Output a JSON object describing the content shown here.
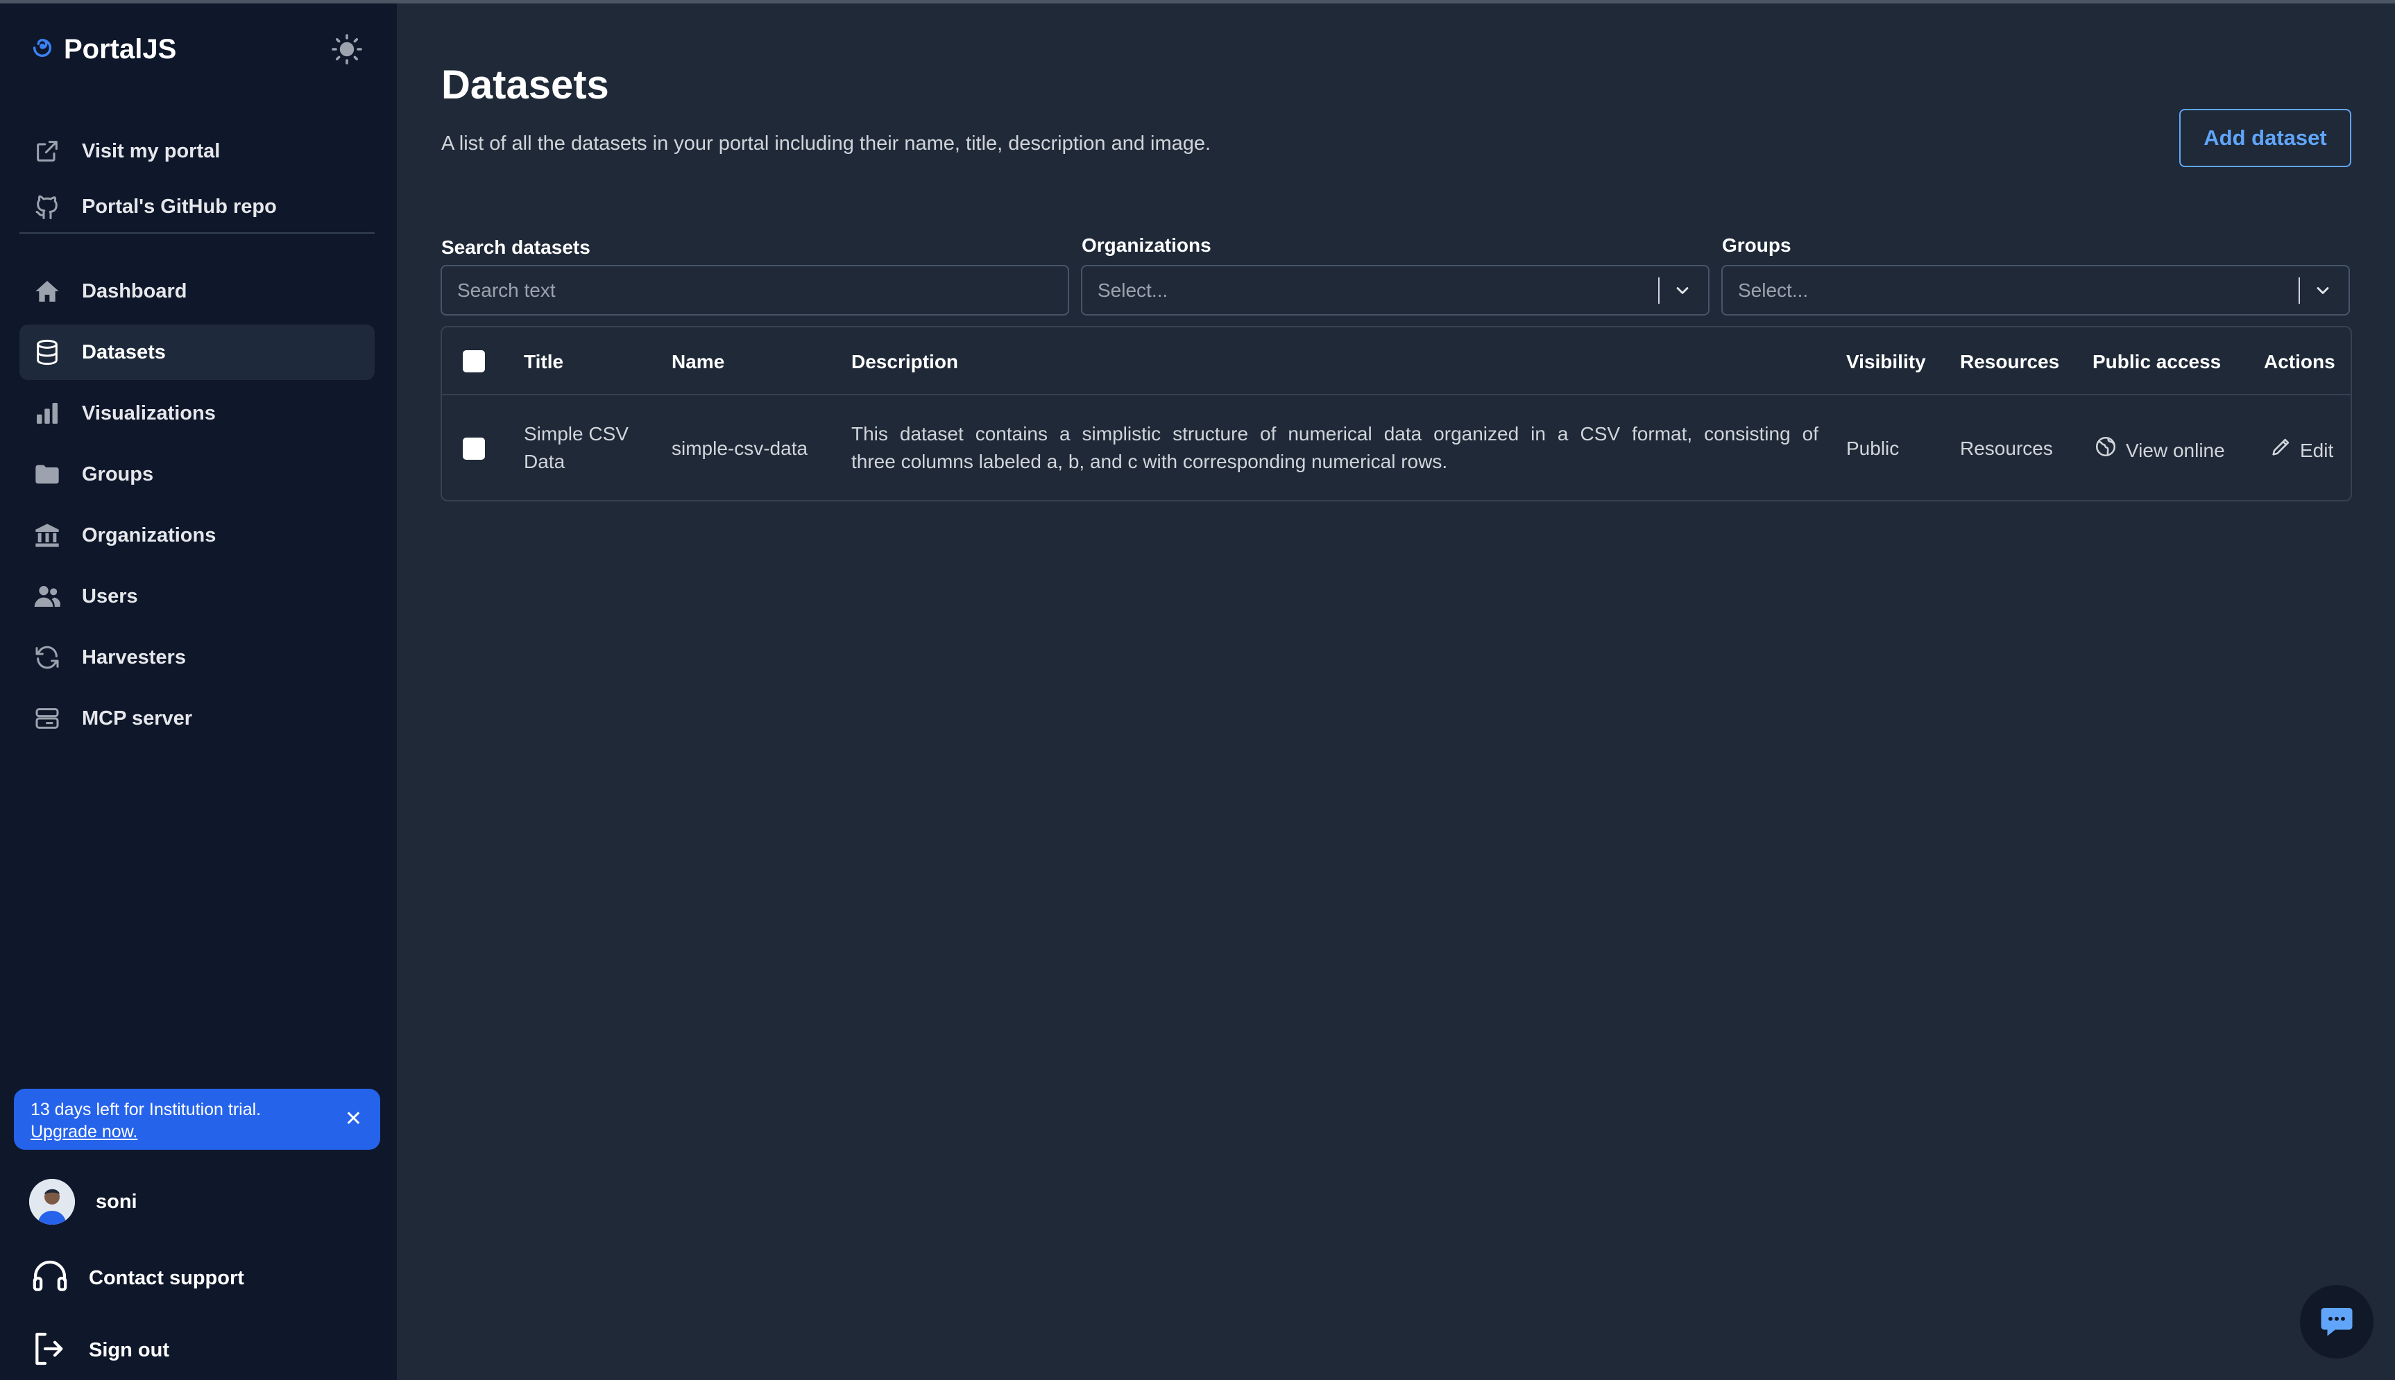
{
  "app": {
    "brand": "PortalJS"
  },
  "sidebar": {
    "top_links": [
      {
        "label": "Visit my portal",
        "icon": "external-link-icon"
      },
      {
        "label": "Portal's GitHub repo",
        "icon": "github-icon"
      }
    ],
    "nav": [
      {
        "label": "Dashboard",
        "icon": "home-icon"
      },
      {
        "label": "Datasets",
        "icon": "database-icon",
        "active": true
      },
      {
        "label": "Visualizations",
        "icon": "bar-chart-icon"
      },
      {
        "label": "Groups",
        "icon": "folder-icon"
      },
      {
        "label": "Organizations",
        "icon": "building-icon"
      },
      {
        "label": "Users",
        "icon": "users-icon"
      },
      {
        "label": "Harvesters",
        "icon": "refresh-icon"
      },
      {
        "label": "MCP server",
        "icon": "server-icon"
      }
    ],
    "trial": {
      "text": "13 days left for Institution trial.",
      "link": "Upgrade now.",
      "close": "✕"
    },
    "user": {
      "name": "soni"
    },
    "contact_support": "Contact support",
    "sign_out": "Sign out"
  },
  "main": {
    "title": "Datasets",
    "subtitle": "A list of all the datasets in your portal including their name, title, description and image.",
    "add_button": "Add dataset",
    "filters": {
      "search_label": "Search datasets",
      "search_placeholder": "Search text",
      "org_label": "Organizations",
      "org_placeholder": "Select...",
      "groups_label": "Groups",
      "groups_placeholder": "Select..."
    },
    "table": {
      "headers": {
        "title": "Title",
        "name": "Name",
        "description": "Description",
        "visibility": "Visibility",
        "resources": "Resources",
        "public_access": "Public access",
        "actions": "Actions"
      },
      "rows": [
        {
          "title_line1": "Simple CSV",
          "title_line2": "Data",
          "name": "simple-csv-data",
          "desc_line1": "This dataset contains a simplistic structure of numerical data organized in a CSV format, consisting of",
          "desc_line2": "three columns labeled a, b, and c with corresponding numerical rows.",
          "visibility": "Public",
          "resources": "Resources",
          "public_access": "View online",
          "action": "Edit"
        }
      ]
    }
  },
  "colors": {
    "accent": "#60a5fa",
    "trial_bg": "#2563eb",
    "sidebar_bg": "#0f172a",
    "main_bg": "#1f2937"
  }
}
